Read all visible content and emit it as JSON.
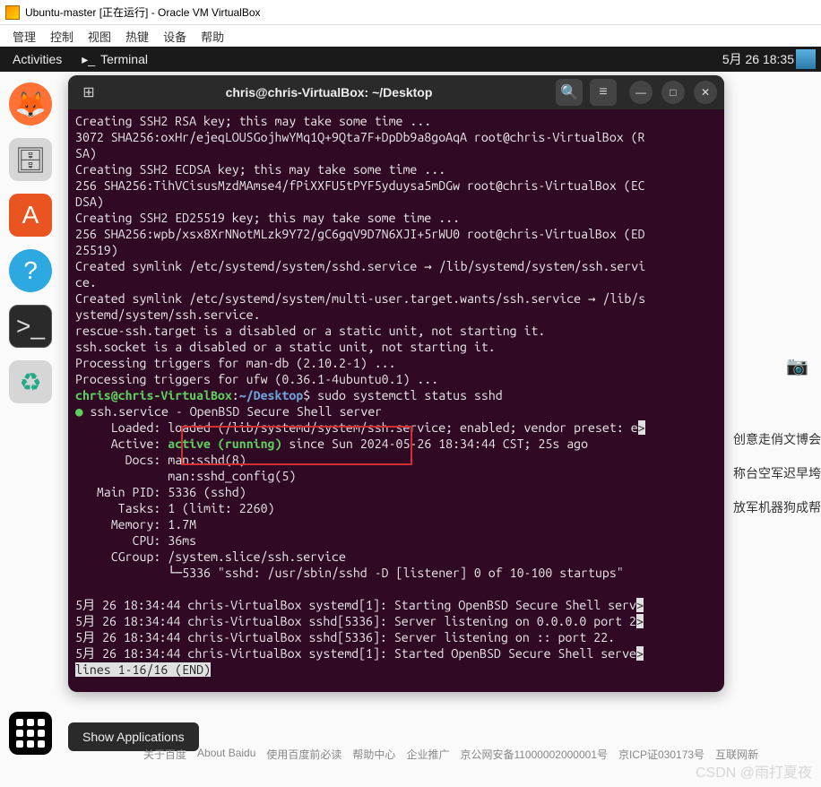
{
  "vbox": {
    "title": "Ubuntu-master [正在运行] - Oracle VM VirtualBox",
    "menu": [
      "管理",
      "控制",
      "视图",
      "热键",
      "设备",
      "帮助"
    ]
  },
  "ubuntu_bar": {
    "activities": "Activities",
    "terminal_label": "Terminal",
    "clock": "5月 26  18:35"
  },
  "dock_tooltip": "Show Applications",
  "terminal": {
    "title": "chris@chris-VirtualBox: ~/Desktop",
    "prompt_user": "chris@chris-VirtualBox",
    "prompt_sep": ":",
    "prompt_path": "~/Desktop",
    "prompt_dollar": "$",
    "command": " sudo systemctl status sshd",
    "lines": {
      "l1": "Creating SSH2 RSA key; this may take some time ...",
      "l2": "3072 SHA256:oxHr/ejeqLOUSGojhwYMq1Q+9Qta7F+DpDb9a8goAqA root@chris-VirtualBox (R",
      "l3": "SA)",
      "l4": "Creating SSH2 ECDSA key; this may take some time ...",
      "l5": "256 SHA256:TihVCisusMzdMAmse4/fPiXXFU5tPYF5yduysa5mDGw root@chris-VirtualBox (EC",
      "l6": "DSA)",
      "l7": "Creating SSH2 ED25519 key; this may take some time ...",
      "l8": "256 SHA256:wpb/xsx8XrNNotMLzk9Y72/gC6gqV9D7N6XJI+5rWU0 root@chris-VirtualBox (ED",
      "l9": "25519)",
      "l10": "Created symlink /etc/systemd/system/sshd.service → /lib/systemd/system/ssh.servi",
      "l11": "ce.",
      "l12": "Created symlink /etc/systemd/system/multi-user.target.wants/ssh.service → /lib/s",
      "l13": "ystemd/system/ssh.service.",
      "l14": "rescue-ssh.target is a disabled or a static unit, not starting it.",
      "l15": "ssh.socket is a disabled or a static unit, not starting it.",
      "l16": "Processing triggers for man-db (2.10.2-1) ...",
      "l17": "Processing triggers for ufw (0.36.1-4ubuntu0.1) ...",
      "svc1": "● ssh.service - OpenBSD Secure Shell server",
      "svc_loaded": "     Loaded: loaded (/lib/systemd/system/ssh.service; enabled; vendor preset: e",
      "svc_active_pre": "     Active: ",
      "svc_active": "active (running)",
      "svc_active_post": " since Sun 2024-05-26 18:34:44 CST; 25s ago",
      "svc_docs1": "       Docs: man:sshd(8)",
      "svc_docs2": "             man:sshd_config(5)",
      "svc_pid": "   Main PID: 5336 (sshd)",
      "svc_tasks": "      Tasks: 1 (limit: 2260)",
      "svc_mem": "     Memory: 1.7M",
      "svc_cpu": "        CPU: 36ms",
      "svc_cgroup1": "     CGroup: /system.slice/ssh.service",
      "svc_cgroup2": "             └─5336 \"sshd: /usr/sbin/sshd -D [listener] 0 of 10-100 startups\"",
      "log1": "5月 26 18:34:44 chris-VirtualBox systemd[1]: Starting OpenBSD Secure Shell serv",
      "log2": "5月 26 18:34:44 chris-VirtualBox sshd[5336]: Server listening on 0.0.0.0 port 2",
      "log3": "5月 26 18:34:44 chris-VirtualBox sshd[5336]: Server listening on :: port 22.",
      "log4": "5月 26 18:34:44 chris-VirtualBox systemd[1]: Started OpenBSD Secure Shell serve",
      "endline": "lines 1-16/16 (END)"
    }
  },
  "background": {
    "side1": "创意走俏文博会",
    "side2": "称台空军迟早垮",
    "side3": "放军机器狗成帮",
    "footer": [
      "关于百度",
      "About Baidu",
      "使用百度前必读",
      "帮助中心",
      "企业推广",
      "京公网安备11000002000001号",
      "京ICP证030173号",
      "互联网新"
    ]
  },
  "watermark": "CSDN @雨打夏夜"
}
